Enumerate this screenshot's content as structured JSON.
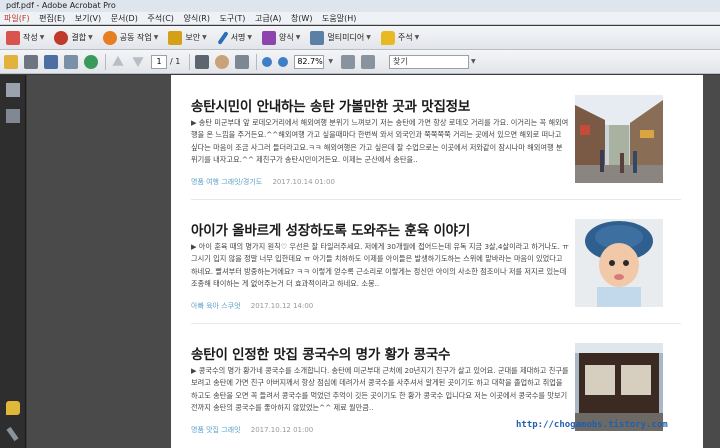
{
  "window": {
    "title": "pdf.pdf - Adobe Acrobat Pro"
  },
  "menu": [
    "파일(F)",
    "편집(E)",
    "보기(V)",
    "문서(D)",
    "주석(C)",
    "양식(R)",
    "도구(T)",
    "고급(A)",
    "창(W)",
    "도움말(H)"
  ],
  "toolbar1": [
    {
      "label": "작성",
      "icon": "create-icon",
      "color": "#d9534f"
    },
    {
      "label": "결합",
      "icon": "combine-icon",
      "color": "#c0392b"
    },
    {
      "label": "공동 작업",
      "icon": "collaborate-icon",
      "color": "#e67e22"
    },
    {
      "label": "보안",
      "icon": "lock-icon",
      "color": "#d4a017"
    },
    {
      "label": "서명",
      "icon": "pen-icon",
      "color": "#2c6fb7"
    },
    {
      "label": "양식",
      "icon": "form-icon",
      "color": "#8e44ad"
    },
    {
      "label": "멀티미디어",
      "icon": "multimedia-icon",
      "color": "#5b7fa6"
    },
    {
      "label": "주석",
      "icon": "comment-icon",
      "color": "#e8b923"
    }
  ],
  "toolbar2": {
    "page_current": "1",
    "page_total": "/ 1",
    "zoom": "82.7%",
    "find_placeholder": "찾기"
  },
  "posts": [
    {
      "title": "송탄시민이 안내하는 송탄 가볼만한 곳과 맛집정보",
      "text": "▶ 송탄 미군부대 앞 로데오거리에서 해외여행 분위기 느껴보기 저는 송탄에 가면 항상 로데오 거리를 가요. 이거리는 꼭 해외여행을 온 느낌을 주거든요.^^해외여행 가고 싶을때마다 한번씩 와서 외국인과 쭉쭉쭉쭉 거리는 곳에서 있으면 해외로 떠나고 싶다는 마음이 조금 사그러 들더라고요.ㅋㅋ 해외여행은 가고 싶은데 잘 수업으로는 이곳에서 저와같이 잠시나마 해외여행 분위기를 내자고요.^^ 제친구가 송탄시민이거든요. 이제는 군산에서 송탄을..",
      "category": "명품 여행 그래잇/경기도",
      "date": "2017.10.14 01:00"
    },
    {
      "title": "아이가 올바르게 성장하도록 도와주는 훈육 이야기",
      "text": "▶ 아이 훈육 때의 명가지 원칙♡ 우선은 잘 타일러주세요. 저에게 30개월에 접어드는데 유독 지금 3살,4살이라고 하거나도. ㅠ 그시기 입지 않을 정말 너무 입한데요 ㅠ 아기들 치하하도 이제를 아이들은 발생하기도하는 스위에 맡바라는 마음이 있었다고 하네요. 빨셔부터 방중하는거에요? ㅋㅋ 이렇게 얻수록 근소리로 이렇게는 정신만 아이의 사소한 점조이나 저를 저지르 있는데 조종해 태이하는 게 없어주는거 더 효과적이라고 하네요. 소봉..",
      "category": "아빠 육아 스쿠엇",
      "date": "2017.10.12 14:00"
    },
    {
      "title": "송탄이 인정한 맛집 콩국수의 명가 황가 콩국수",
      "text": "▶ 콩국수의 명가 황가네 콩국수를 소개합니다. 송탄에 미군부대 근처에 20년지기 친구가 살고 있어요. 군대를 제대하고 친구를 보려고 송탄에 가면 친구 아버지께서 항상 점심에 데려가서 콩국수를 사주셔서 알게된 곳이기도 하고 대학을 졸업하고 취업을 하고도 송탄을 오면 꼭 들려서 콩국수를 먹었던 추억이 깃든 곳이기도 한 황가 콩국수 입니다요 저는 이곳에서 콩국수를 맛보기 전까지 송탄의 콩국수를 좋아하지 않았었는^^ 제료 월만큼..",
      "category": "명품 맛집 그래잇",
      "date": "2017.10.12 01:00"
    }
  ],
  "watermark": "http://chogamobs.tistory.com"
}
